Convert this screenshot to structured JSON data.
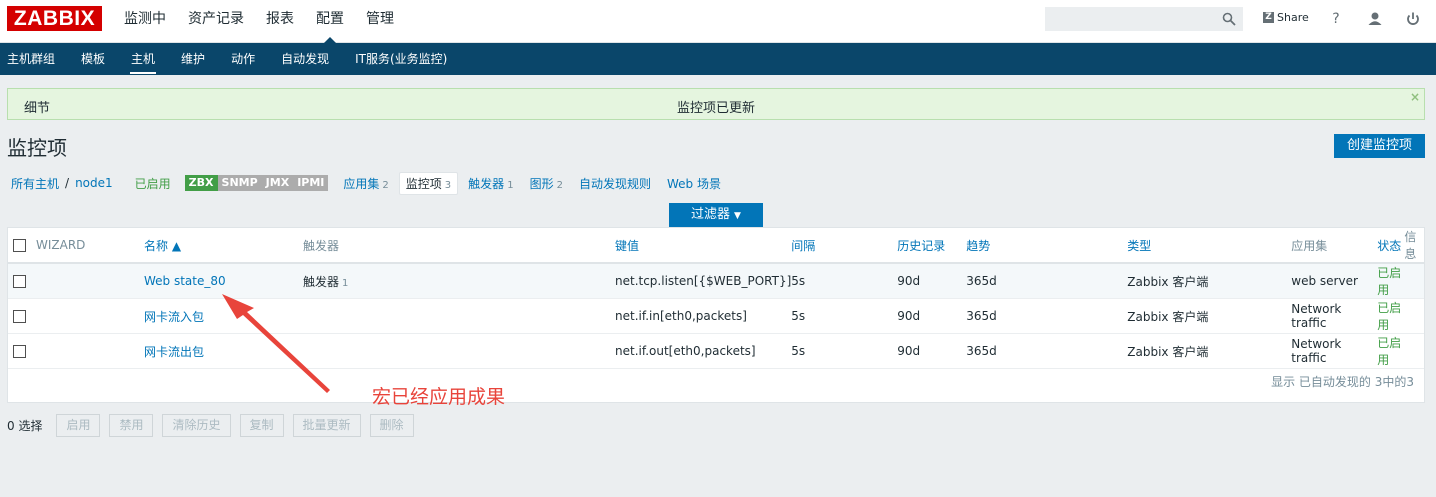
{
  "header": {
    "logo": "ZABBIX",
    "menu": [
      "监测中",
      "资产记录",
      "报表",
      "配置",
      "管理"
    ],
    "active_menu": "配置",
    "search_placeholder": "",
    "share_label": "Share",
    "help_label": "?"
  },
  "subnav": {
    "items": [
      "主机群组",
      "模板",
      "主机",
      "维护",
      "动作",
      "自动发现",
      "IT服务(业务监控)"
    ],
    "active": "主机"
  },
  "message": {
    "details_label": "细节",
    "text": "监控项已更新",
    "close": "×"
  },
  "page": {
    "title": "监控项",
    "create_button": "创建监控项"
  },
  "hostnav": {
    "all_hosts": "所有主机",
    "separator": "/",
    "host": "node1",
    "status": "已启用",
    "tags": [
      "ZBX",
      "SNMP",
      "JMX",
      "IPMI"
    ],
    "tabs": [
      {
        "label": "应用集",
        "count": "2"
      },
      {
        "label": "监控项",
        "count": "3"
      },
      {
        "label": "触发器",
        "count": "1"
      },
      {
        "label": "图形",
        "count": "2"
      },
      {
        "label": "自动发现规则",
        "count": ""
      },
      {
        "label": "Web 场景",
        "count": ""
      }
    ]
  },
  "filter": {
    "label": "过滤器"
  },
  "table": {
    "headers": [
      "WIZARD",
      "名称 ▲",
      "触发器",
      "键值",
      "间隔",
      "历史记录",
      "趋势",
      "类型",
      "应用集",
      "状态",
      "信息"
    ],
    "rows": [
      {
        "name": "Web state_80",
        "trigger": "触发器",
        "trigger_count": "1",
        "key": "net.tcp.listen[{$WEB_PORT}]",
        "interval": "5s",
        "history": "90d",
        "trends": "365d",
        "type": "Zabbix 客户端",
        "app": "web server",
        "status": "已启用"
      },
      {
        "name": "网卡流入包",
        "trigger": "",
        "trigger_count": "",
        "key": "net.if.in[eth0,packets]",
        "interval": "5s",
        "history": "90d",
        "trends": "365d",
        "type": "Zabbix 客户端",
        "app": "Network traffic",
        "status": "已启用"
      },
      {
        "name": "网卡流出包",
        "trigger": "",
        "trigger_count": "",
        "key": "net.if.out[eth0,packets]",
        "interval": "5s",
        "history": "90d",
        "trends": "365d",
        "type": "Zabbix 客户端",
        "app": "Network traffic",
        "status": "已启用"
      }
    ],
    "footer": "显示 已自动发现的 3中的3"
  },
  "actions": {
    "selected": "0 选择",
    "buttons": [
      "启用",
      "禁用",
      "清除历史",
      "复制",
      "批量更新",
      "删除"
    ]
  },
  "annotation": {
    "text": "宏已经应用成果",
    "color": "#e8443b"
  }
}
